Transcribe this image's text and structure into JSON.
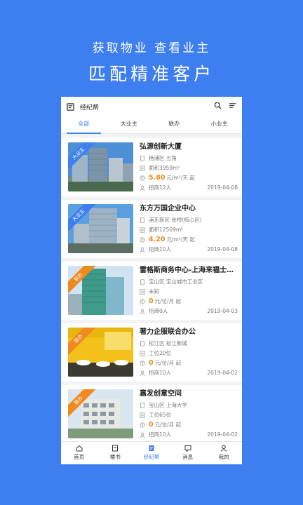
{
  "promo": {
    "line1": "获取物业  查看业主",
    "line2": "匹配精准客户"
  },
  "app": {
    "title": "经纪帮"
  },
  "tabs": [
    {
      "label": "全部"
    },
    {
      "label": "大业主"
    },
    {
      "label": "联办"
    },
    {
      "label": "小业主"
    }
  ],
  "listings": [
    {
      "badge": "大业主",
      "badge_color": "#3d7ef0",
      "name": "弘源创新大厦",
      "location": "杨浦区  五角",
      "area": "面积3959m²",
      "price_value": "5.80",
      "price_unit": "元/m²/天 起",
      "agents": "招商12人",
      "date": "2019-04-08"
    },
    {
      "badge": "大业主",
      "badge_color": "#3d7ef0",
      "name": "东方万国企业中心",
      "location": "浦东新区  金桥(核心区)",
      "area": "面积12509m²",
      "price_value": "4.20",
      "price_unit": "元/m²/天 起",
      "agents": "招商10人",
      "date": "2019-04-08"
    },
    {
      "badge": "联办",
      "badge_color": "#f08a1e",
      "name": "雷格斯商务中心-上海来福士广场",
      "location": "宝山区  宝山城市工业区",
      "area": "未知",
      "price_value": "0",
      "price_unit": "元/位/月 起",
      "agents": "招商0人",
      "date": "2019-04-03"
    },
    {
      "badge": "联办",
      "badge_color": "#f08a1e",
      "name": "著力企服联合办公",
      "location": "松江区  松江新城",
      "area": "工位20位",
      "price_value": "0",
      "price_unit": "元/位/月 起",
      "agents": "招商10人",
      "date": "2019-04-02"
    },
    {
      "badge": "联办",
      "badge_color": "#f08a1e",
      "name": "嘉发创意空间",
      "location": "宝山区  上海大学",
      "area": "工位65位",
      "price_value": "0",
      "price_unit": "元/位/月 起",
      "agents": "招商10人",
      "date": "2019-04-02"
    }
  ],
  "nav": [
    {
      "label": "首页",
      "icon": "home-icon"
    },
    {
      "label": "楼书",
      "icon": "book-icon"
    },
    {
      "label": "经纪帮",
      "icon": "document-icon"
    },
    {
      "label": "消息",
      "icon": "message-icon"
    },
    {
      "label": "我的",
      "icon": "user-icon"
    }
  ],
  "active_tab": 0,
  "active_nav": 2
}
